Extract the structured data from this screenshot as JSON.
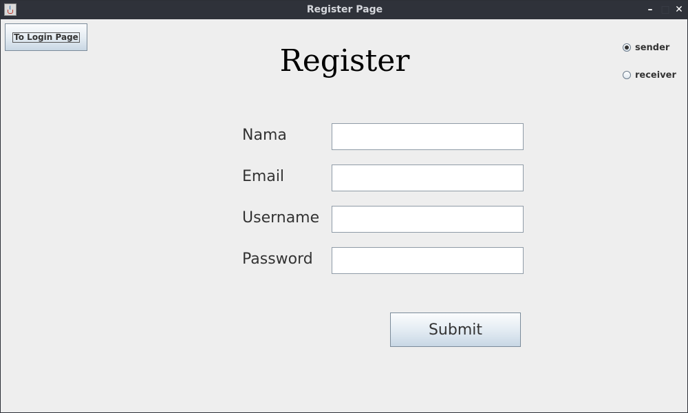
{
  "window": {
    "title": "Register Page",
    "controls": {
      "minimize": "–",
      "maximize": "□",
      "close": "✕"
    },
    "icon": "java-app-icon"
  },
  "toolbar": {
    "login_button_label": "To Login Page"
  },
  "page": {
    "heading": "Register"
  },
  "role_options": [
    {
      "label": "sender",
      "selected": true
    },
    {
      "label": "receiver",
      "selected": false
    }
  ],
  "form": {
    "fields": [
      {
        "label": "Nama",
        "value": ""
      },
      {
        "label": "Email",
        "value": ""
      },
      {
        "label": "Username",
        "value": ""
      },
      {
        "label": "Password",
        "value": ""
      }
    ],
    "submit_label": "Submit"
  }
}
